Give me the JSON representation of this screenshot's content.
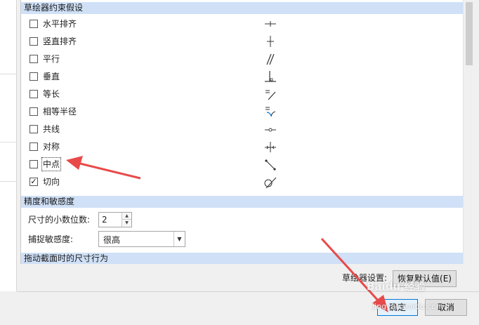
{
  "constraints_section": {
    "title": "草绘器约束假设",
    "items": [
      {
        "label": "水平排齐",
        "checked": false,
        "icon": "horizontal-constraint-icon"
      },
      {
        "label": "竖直排齐",
        "checked": false,
        "icon": "vertical-constraint-icon"
      },
      {
        "label": "平行",
        "checked": false,
        "icon": "parallel-constraint-icon"
      },
      {
        "label": "垂直",
        "checked": false,
        "icon": "perpendicular-constraint-icon"
      },
      {
        "label": "等长",
        "checked": false,
        "icon": "equal-length-constraint-icon"
      },
      {
        "label": "相等半径",
        "checked": false,
        "icon": "equal-radius-constraint-icon"
      },
      {
        "label": "共线",
        "checked": false,
        "icon": "collinear-constraint-icon"
      },
      {
        "label": "对称",
        "checked": false,
        "icon": "symmetric-constraint-icon"
      },
      {
        "label": "中点",
        "checked": false,
        "icon": "midpoint-constraint-icon"
      },
      {
        "label": "切向",
        "checked": true,
        "icon": "tangent-constraint-icon"
      }
    ]
  },
  "precision_section": {
    "title": "精度和敏感度",
    "decimals_label": "尺寸的小数位数:",
    "decimals_value": "2",
    "sensitivity_label": "捕捉敏感度:",
    "sensitivity_value": "很高"
  },
  "drag_section": {
    "title": "拖动截面时的尺寸行为"
  },
  "footer": {
    "settings_label": "草绘器设置:",
    "restore_defaults_label": "恢复默认值(E)",
    "ok_label": "确定",
    "cancel_label": "取消"
  },
  "watermark": {
    "brand": "Baidu 经验",
    "url": "jingyan.baidu.com"
  },
  "colors": {
    "section_header_bg": "#cfe0f7",
    "annotation_arrow": "#e84a4a",
    "primary_button_border": "#0078d7"
  }
}
